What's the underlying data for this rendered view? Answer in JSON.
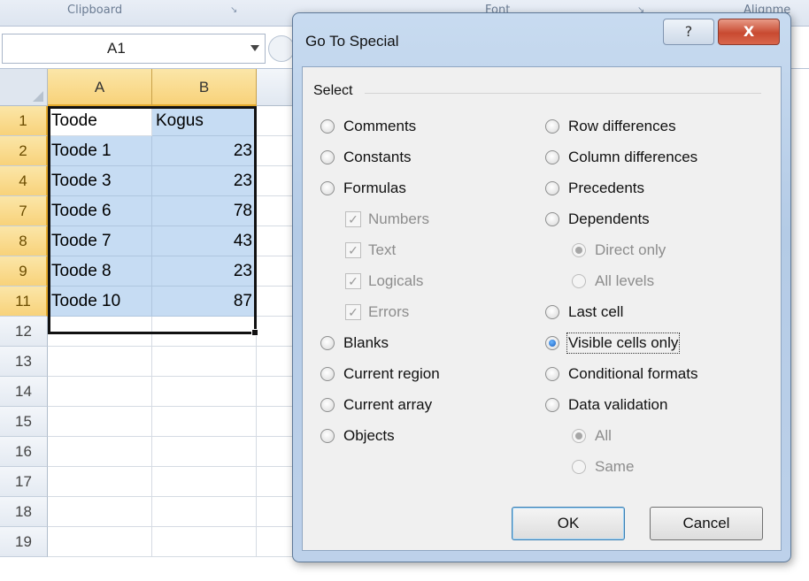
{
  "ribbon": {
    "groups": [
      "Clipboard",
      "Font",
      "Alignme"
    ],
    "launcher_icon": "dialog-launcher-icon"
  },
  "name_box": {
    "value": "A1"
  },
  "grid": {
    "columns": [
      "A",
      "B"
    ],
    "rows": [
      {
        "num": "1",
        "a": "Toode",
        "b": "Kogus",
        "selected": true
      },
      {
        "num": "2",
        "a": "Toode 1",
        "b": "23",
        "selected": true
      },
      {
        "num": "4",
        "a": "Toode 3",
        "b": "23",
        "selected": true
      },
      {
        "num": "7",
        "a": "Toode 6",
        "b": "78",
        "selected": true
      },
      {
        "num": "8",
        "a": "Toode 7",
        "b": "43",
        "selected": true
      },
      {
        "num": "9",
        "a": "Toode 8",
        "b": "23",
        "selected": true
      },
      {
        "num": "11",
        "a": "Toode 10",
        "b": "87",
        "selected": true
      },
      {
        "num": "12",
        "a": "",
        "b": "",
        "selected": false
      },
      {
        "num": "13",
        "a": "",
        "b": "",
        "selected": false
      },
      {
        "num": "14",
        "a": "",
        "b": "",
        "selected": false
      },
      {
        "num": "15",
        "a": "",
        "b": "",
        "selected": false
      },
      {
        "num": "16",
        "a": "",
        "b": "",
        "selected": false
      },
      {
        "num": "17",
        "a": "",
        "b": "",
        "selected": false
      },
      {
        "num": "18",
        "a": "",
        "b": "",
        "selected": false
      },
      {
        "num": "19",
        "a": "",
        "b": "",
        "selected": false
      }
    ]
  },
  "dialog": {
    "title": "Go To Special",
    "help_label": "?",
    "close_label": "X",
    "group_label": "Select",
    "left_options": [
      {
        "label": "Comments",
        "type": "radio",
        "checked": false,
        "disabled": false
      },
      {
        "label": "Constants",
        "type": "radio",
        "checked": false,
        "disabled": false
      },
      {
        "label": "Formulas",
        "type": "radio",
        "checked": false,
        "disabled": false
      },
      {
        "label": "Numbers",
        "type": "check",
        "checked": true,
        "disabled": true
      },
      {
        "label": "Text",
        "type": "check",
        "checked": true,
        "disabled": true
      },
      {
        "label": "Logicals",
        "type": "check",
        "checked": true,
        "disabled": true
      },
      {
        "label": "Errors",
        "type": "check",
        "checked": true,
        "disabled": true
      },
      {
        "label": "Blanks",
        "type": "radio",
        "checked": false,
        "disabled": false
      },
      {
        "label": "Current region",
        "type": "radio",
        "checked": false,
        "disabled": false
      },
      {
        "label": "Current array",
        "type": "radio",
        "checked": false,
        "disabled": false
      },
      {
        "label": "Objects",
        "type": "radio",
        "checked": false,
        "disabled": false
      }
    ],
    "right_options": [
      {
        "label": "Row differences",
        "type": "radio",
        "checked": false,
        "disabled": false
      },
      {
        "label": "Column differences",
        "type": "radio",
        "checked": false,
        "disabled": false
      },
      {
        "label": "Precedents",
        "type": "radio",
        "checked": false,
        "disabled": false
      },
      {
        "label": "Dependents",
        "type": "radio",
        "checked": false,
        "disabled": false
      },
      {
        "label": "Direct only",
        "type": "radio",
        "checked": true,
        "disabled": true
      },
      {
        "label": "All levels",
        "type": "radio",
        "checked": false,
        "disabled": true
      },
      {
        "label": "Last cell",
        "type": "radio",
        "checked": false,
        "disabled": false
      },
      {
        "label": "Visible cells only",
        "type": "radio",
        "checked": true,
        "disabled": false
      },
      {
        "label": "Conditional formats",
        "type": "radio",
        "checked": false,
        "disabled": false
      },
      {
        "label": "Data validation",
        "type": "radio",
        "checked": false,
        "disabled": false
      },
      {
        "label": "All",
        "type": "radio",
        "checked": true,
        "disabled": true
      },
      {
        "label": "Same",
        "type": "radio",
        "checked": false,
        "disabled": true
      }
    ],
    "ok_label": "OK",
    "cancel_label": "Cancel"
  },
  "colors": {
    "selection_fill": "#c6dcf3",
    "header_highlight": "#f8d27a",
    "close_button": "#c84a31"
  }
}
